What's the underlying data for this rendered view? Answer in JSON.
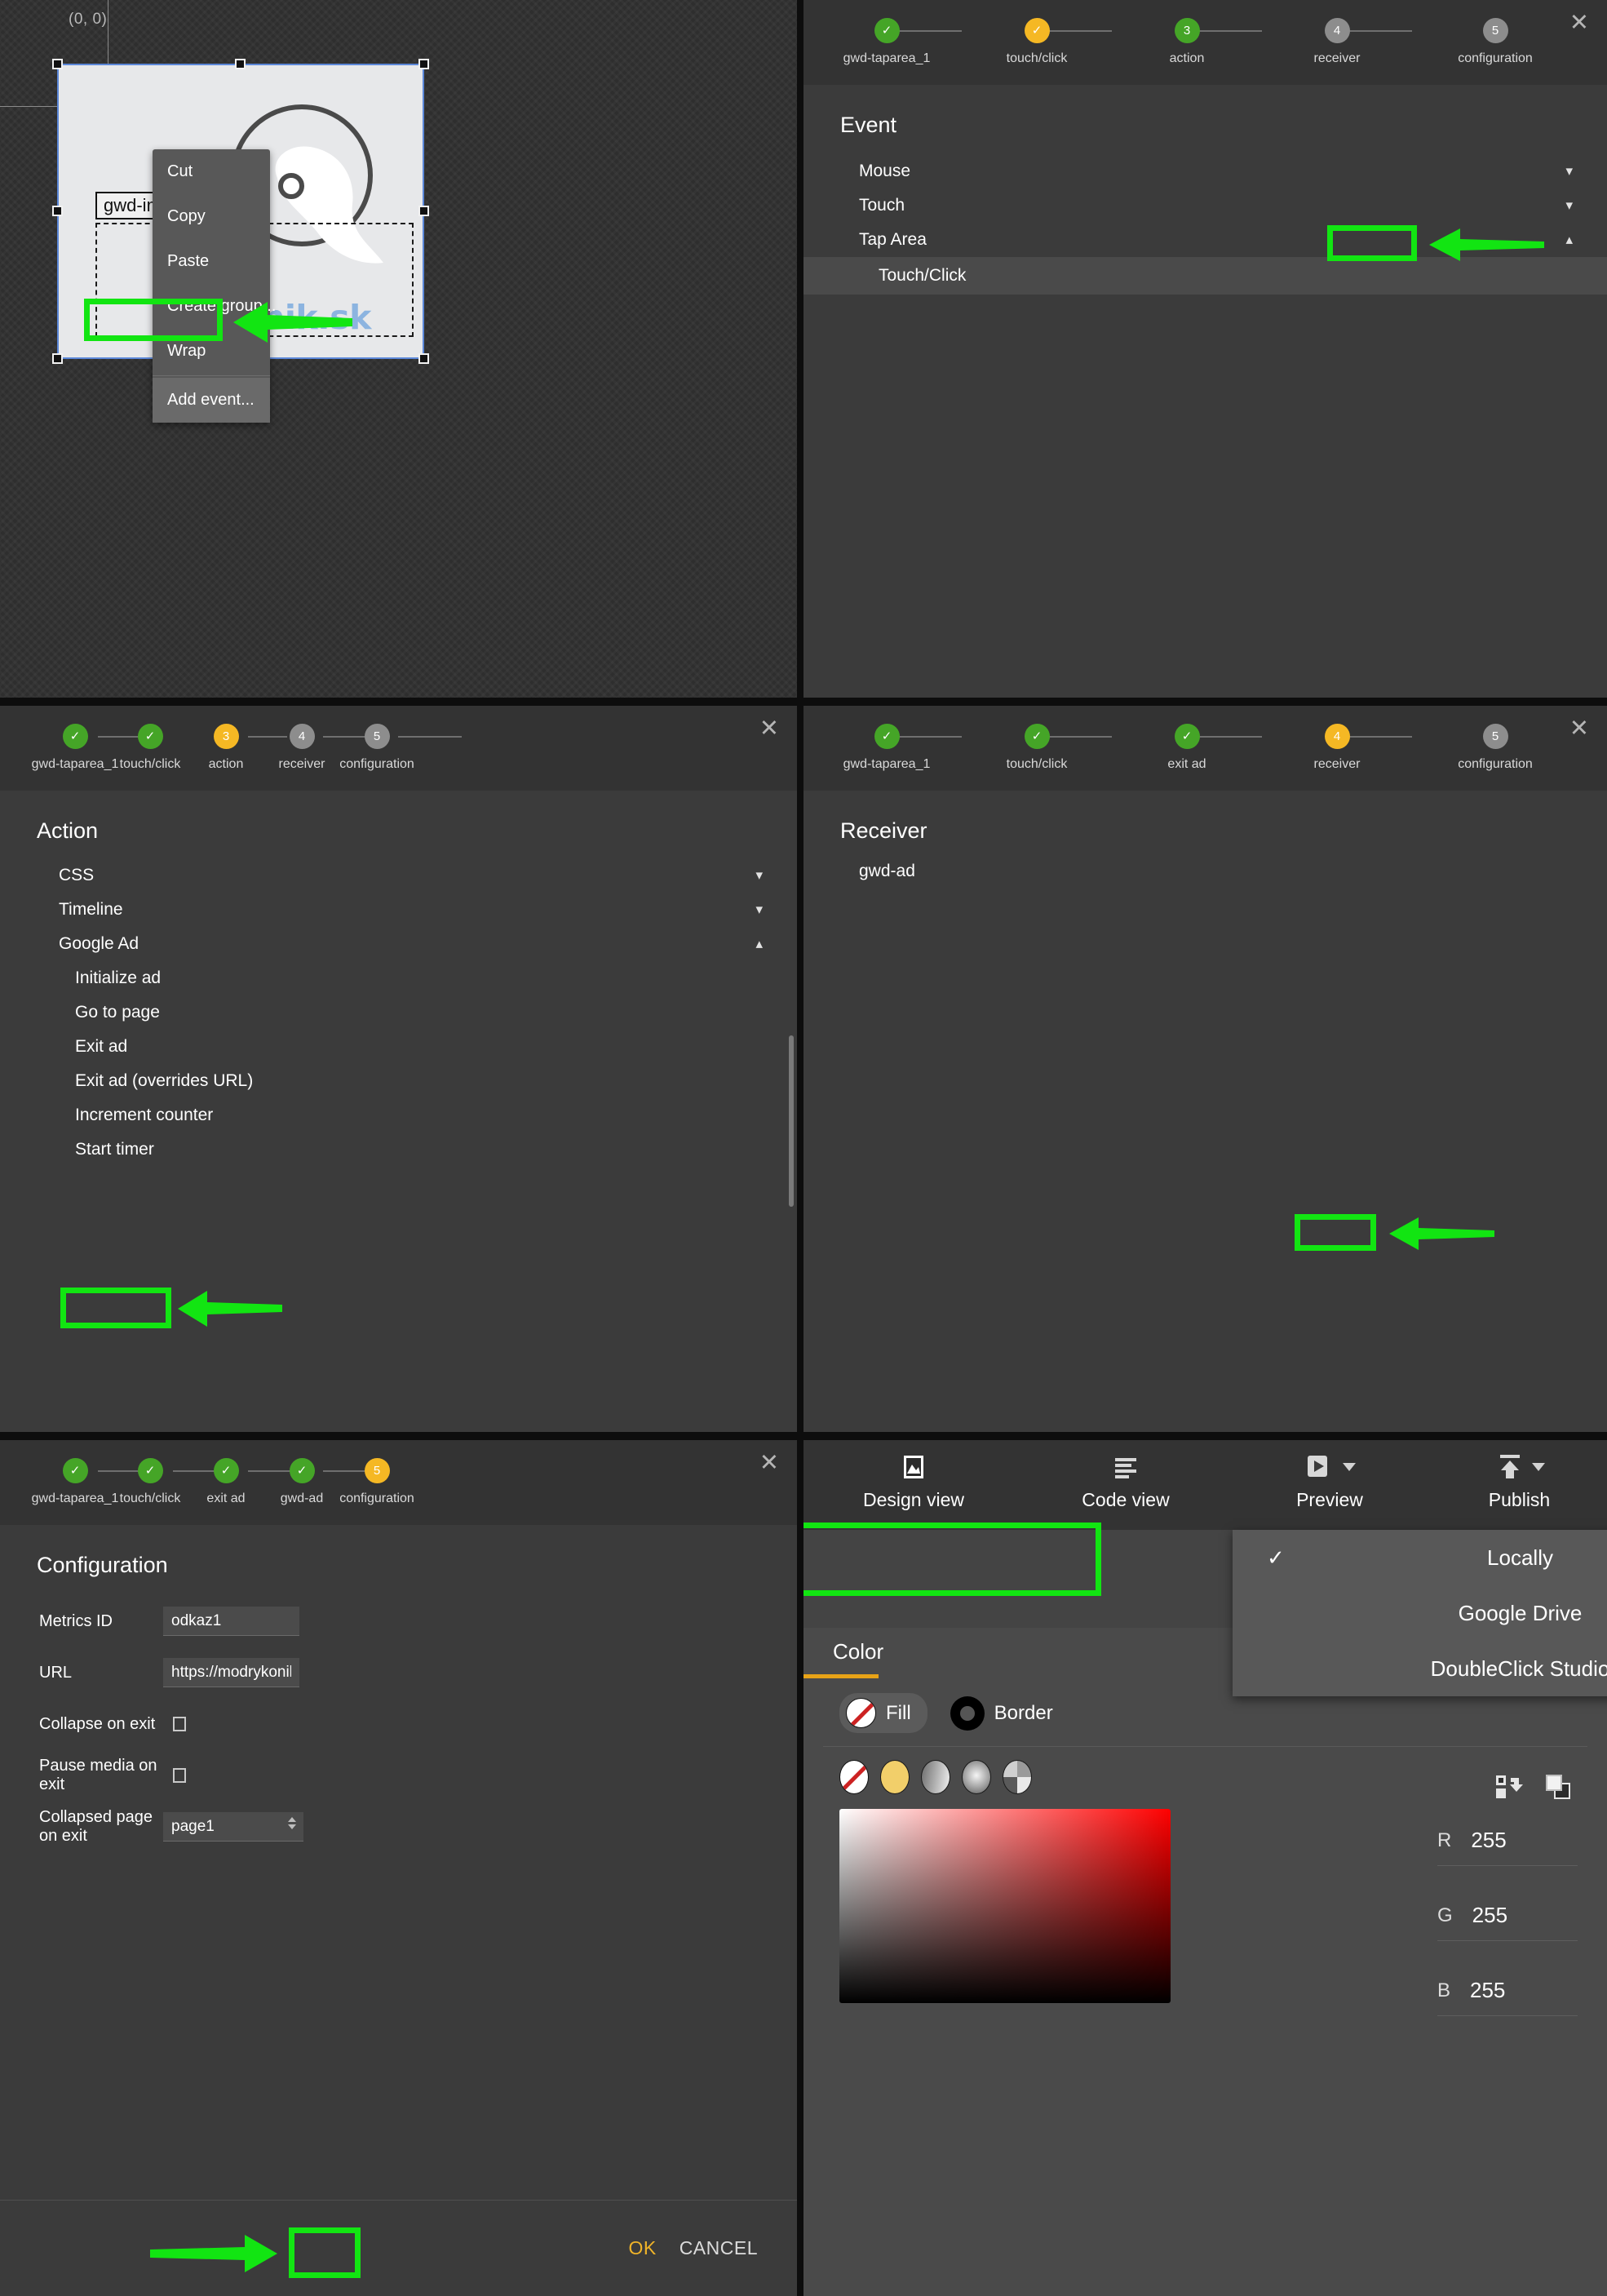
{
  "canvas": {
    "origin_label": "(0, 0)",
    "element_tag": "gwd-image_1",
    "brand_text": "drykonik.sk",
    "context_menu": {
      "items": [
        "Cut",
        "Copy",
        "Paste",
        "Create group...",
        "Wrap"
      ],
      "highlighted_item": "Add event..."
    }
  },
  "wizard_event": {
    "steps": [
      {
        "label": "gwd-taparea_1",
        "state": "done",
        "marker": "✓"
      },
      {
        "label": "touch/click",
        "state": "current",
        "marker": "✓"
      },
      {
        "label": "action",
        "state": "green-num",
        "marker": "3"
      },
      {
        "label": "receiver",
        "state": "pending",
        "marker": "4"
      },
      {
        "label": "configuration",
        "state": "pending",
        "marker": "5"
      }
    ],
    "title": "Event",
    "groups": [
      {
        "label": "Mouse",
        "expanded": false
      },
      {
        "label": "Touch",
        "expanded": false
      },
      {
        "label": "Tap Area",
        "expanded": true
      }
    ],
    "selected_item": "Touch/Click",
    "close_label": "✕"
  },
  "wizard_action": {
    "steps": [
      {
        "label": "gwd-taparea_1",
        "state": "done",
        "marker": "✓"
      },
      {
        "label": "touch/click",
        "state": "done",
        "marker": "✓"
      },
      {
        "label": "action",
        "state": "current",
        "marker": "3"
      },
      {
        "label": "receiver",
        "state": "pending",
        "marker": "4"
      },
      {
        "label": "configuration",
        "state": "pending",
        "marker": "5"
      }
    ],
    "title": "Action",
    "groups": [
      {
        "label": "CSS",
        "expanded": false
      },
      {
        "label": "Timeline",
        "expanded": false
      },
      {
        "label": "Google Ad",
        "expanded": true
      }
    ],
    "items": [
      "Initialize ad",
      "Go to page",
      "Exit ad",
      "Exit ad (overrides URL)",
      "Increment counter",
      "Start timer"
    ],
    "selected_item": "Exit ad",
    "close_label": "✕"
  },
  "wizard_receiver": {
    "steps": [
      {
        "label": "gwd-taparea_1",
        "state": "done",
        "marker": "✓"
      },
      {
        "label": "touch/click",
        "state": "done",
        "marker": "✓"
      },
      {
        "label": "exit ad",
        "state": "done",
        "marker": "✓"
      },
      {
        "label": "receiver",
        "state": "current",
        "marker": "4"
      },
      {
        "label": "configuration",
        "state": "pending",
        "marker": "5"
      }
    ],
    "title": "Receiver",
    "selected_item": "gwd-ad",
    "close_label": "✕"
  },
  "wizard_configuration": {
    "steps": [
      {
        "label": "gwd-taparea_1",
        "state": "done",
        "marker": "✓"
      },
      {
        "label": "touch/click",
        "state": "done",
        "marker": "✓"
      },
      {
        "label": "exit ad",
        "state": "done",
        "marker": "✓"
      },
      {
        "label": "gwd-ad",
        "state": "done",
        "marker": "✓"
      },
      {
        "label": "configuration",
        "state": "current",
        "marker": "5"
      }
    ],
    "title": "Configuration",
    "fields": [
      {
        "label": "Metrics ID",
        "type": "text",
        "value": "odkaz1"
      },
      {
        "label": "URL",
        "type": "text",
        "value": "https://modrykonik.sk"
      },
      {
        "label": "Collapse on exit",
        "type": "checkbox",
        "checked": false
      },
      {
        "label": "Pause media on exit",
        "type": "checkbox",
        "checked": false
      },
      {
        "label": "Collapsed page on exit",
        "type": "select",
        "value": "page1"
      }
    ],
    "ok_label": "OK",
    "cancel_label": "CANCEL",
    "close_label": "✕"
  },
  "editor": {
    "toolbar": [
      {
        "label": "Design view",
        "icon": "image-icon",
        "has_caret": false
      },
      {
        "label": "Code view",
        "icon": "code-lines-icon",
        "has_caret": false
      },
      {
        "label": "Preview",
        "icon": "play-icon",
        "has_caret": true
      },
      {
        "label": "Publish",
        "icon": "upload-icon",
        "has_caret": true
      }
    ],
    "publish_menu": {
      "items": [
        {
          "label": "Locally",
          "checked": true
        },
        {
          "label": "Google Drive",
          "checked": false
        },
        {
          "label": "DoubleClick Studio",
          "checked": false
        }
      ],
      "check_glyph": "✓"
    },
    "color_panel": {
      "tab_label": "Color",
      "fill_label": "Fill",
      "border_label": "Border",
      "swatches": [
        "none",
        "solid",
        "linear-gradient",
        "radial-gradient",
        "pattern"
      ],
      "channels": [
        {
          "key": "R",
          "value": "255"
        },
        {
          "key": "G",
          "value": "255"
        },
        {
          "key": "B",
          "value": "255"
        }
      ],
      "icons": [
        "swap-colors-icon",
        "front-back-colors-icon"
      ]
    }
  },
  "colors": {
    "highlight_green": "#12e512",
    "accent_amber": "#f0b429",
    "step_done": "#45a527",
    "step_current": "#f5b824",
    "step_pending": "#8d8d8d"
  }
}
